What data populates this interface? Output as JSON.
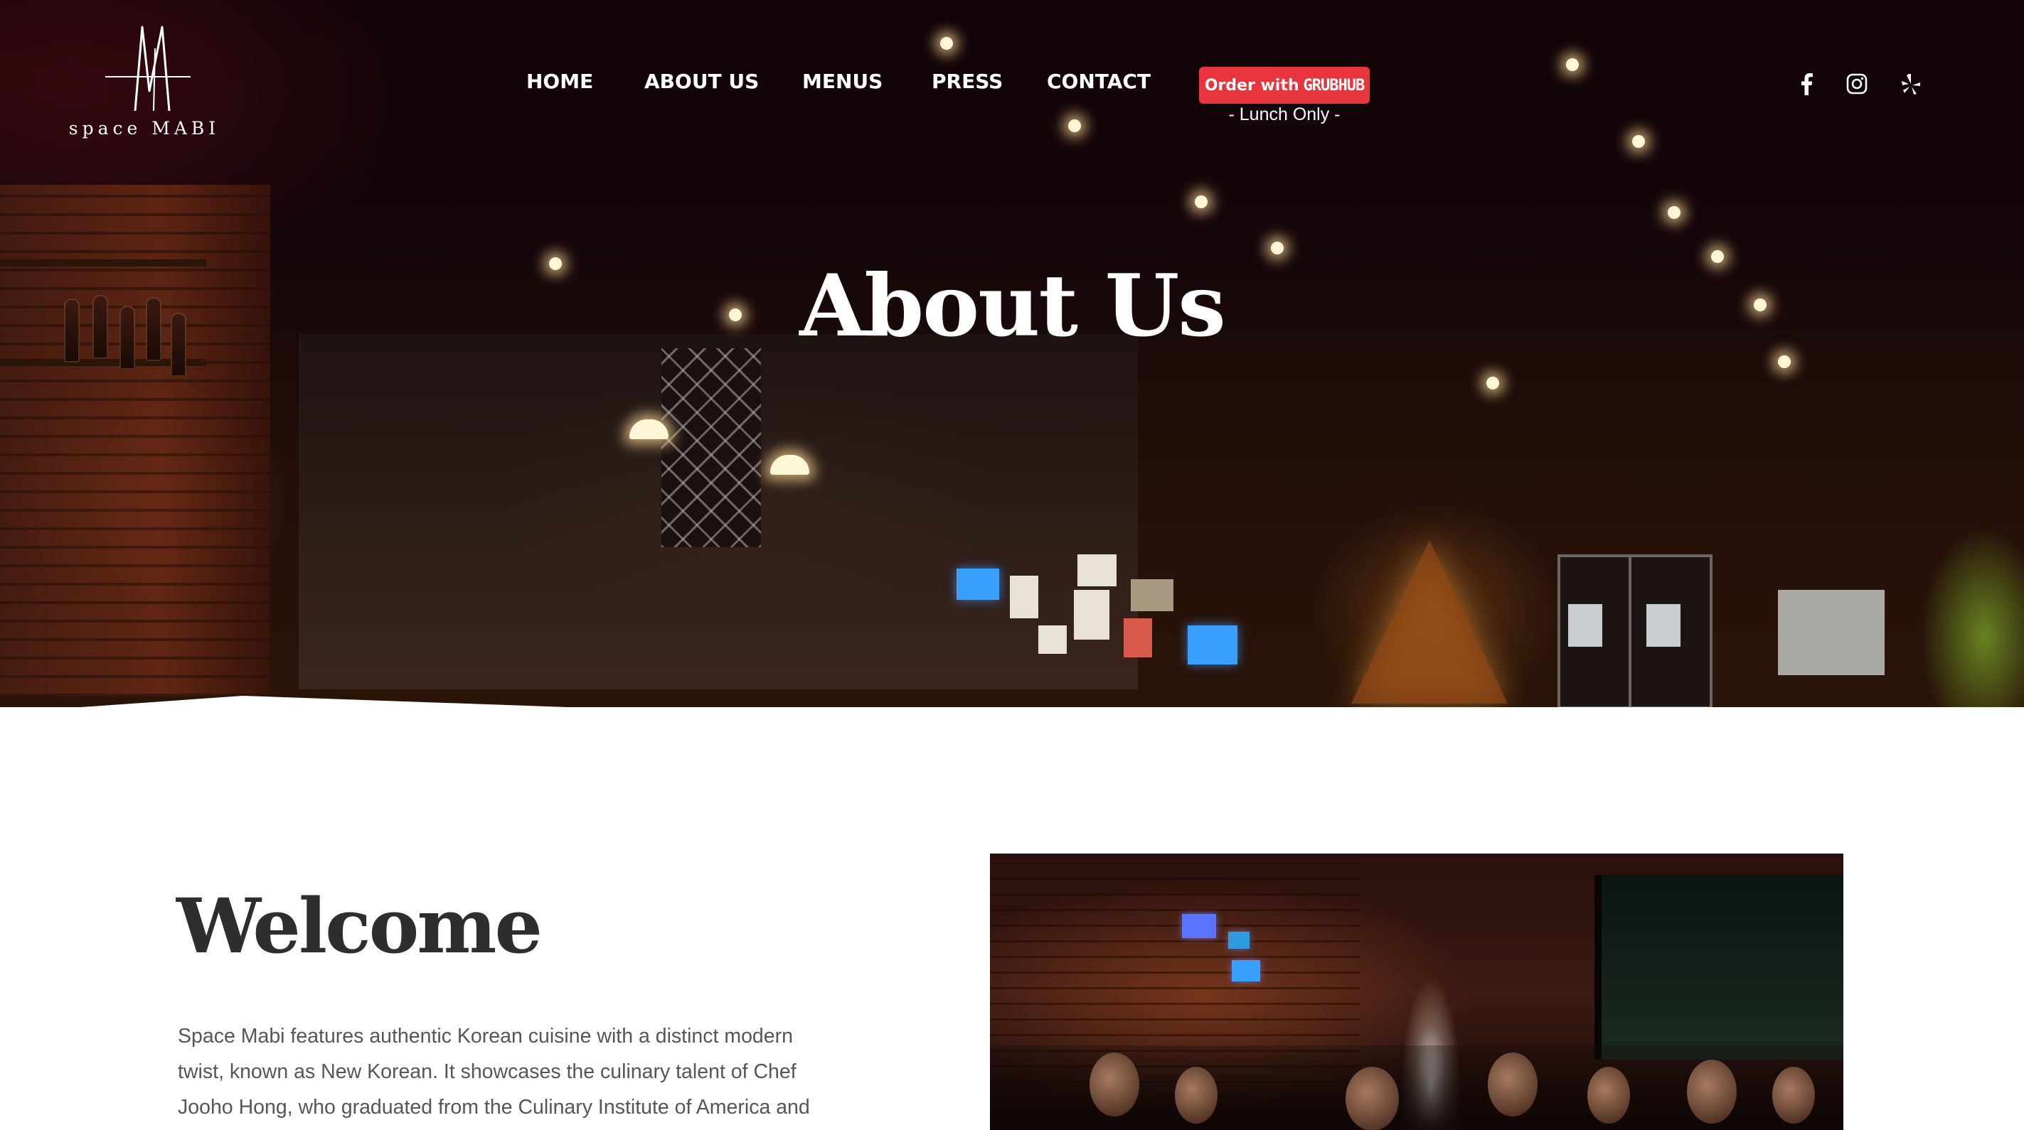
{
  "brand": {
    "logo_text": "space MABI"
  },
  "nav": {
    "items": [
      "HOME",
      "ABOUT US",
      "MENUS",
      "PRESS",
      "CONTACT"
    ],
    "order_button": {
      "prefix": "Order with",
      "brand": "GRUBHUB"
    },
    "order_note": "- Lunch Only -"
  },
  "social": [
    "facebook-icon",
    "instagram-icon",
    "yelp-icon"
  ],
  "hero": {
    "title": "About Us"
  },
  "welcome": {
    "heading": "Welcome",
    "lines": [
      "Space Mabi features authentic Korean cuisine with a distinct modern",
      "twist, known as New Korean. It showcases the culinary talent of Chef",
      "Jooho Hong, who graduated from the Culinary Institute of America and"
    ]
  },
  "colors": {
    "order_button": "#e8343c",
    "heading": "#2e2e2e",
    "body_text": "#565656"
  }
}
